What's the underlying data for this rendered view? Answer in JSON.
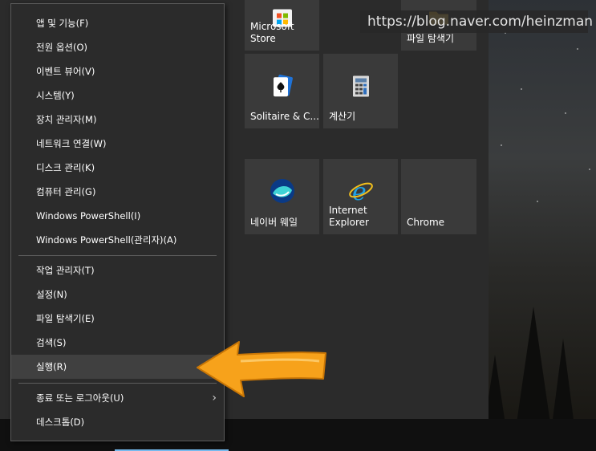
{
  "watermark": {
    "text": "https://blog.naver.com/heinzman"
  },
  "tiles": [
    {
      "id": "store",
      "label": "Microsoft Store",
      "icon": "store-icon"
    },
    {
      "id": "explorer",
      "label": "파일 탐색기",
      "icon": "folder-icon"
    },
    {
      "id": "solitaire",
      "label": "Solitaire & C...",
      "icon": "cards-icon"
    },
    {
      "id": "calc",
      "label": "계산기",
      "icon": "calculator-icon"
    },
    {
      "id": "whale",
      "label": "네이버 웨일",
      "icon": "whale-icon"
    },
    {
      "id": "ie",
      "label": "Internet\nExplorer",
      "icon": "ie-icon"
    },
    {
      "id": "chrome",
      "label": "Chrome",
      "icon": "chrome-icon"
    }
  ],
  "menu": {
    "items": [
      {
        "label": "앱 및 기능(F)"
      },
      {
        "label": "전원 옵션(O)"
      },
      {
        "label": "이벤트 뷰어(V)"
      },
      {
        "label": "시스템(Y)"
      },
      {
        "label": "장치 관리자(M)"
      },
      {
        "label": "네트워크 연결(W)"
      },
      {
        "label": "디스크 관리(K)"
      },
      {
        "label": "컴퓨터 관리(G)"
      },
      {
        "label": "Windows PowerShell(I)"
      },
      {
        "label": "Windows PowerShell(관리자)(A)"
      },
      {
        "label": "작업 관리자(T)"
      },
      {
        "label": "설정(N)"
      },
      {
        "label": "파일 탐색기(E)"
      },
      {
        "label": "검색(S)"
      },
      {
        "label": "실행(R)",
        "highlighted": true
      },
      {
        "label": "종료 또는 로그아웃(U)",
        "submenu": true
      },
      {
        "label": "데스크톱(D)"
      }
    ]
  },
  "colors": {
    "accent": "#76b9ed",
    "arrow": "#f7a21b",
    "menu_bg": "#2b2b2b",
    "tile_bg": "#3a3a3a"
  }
}
